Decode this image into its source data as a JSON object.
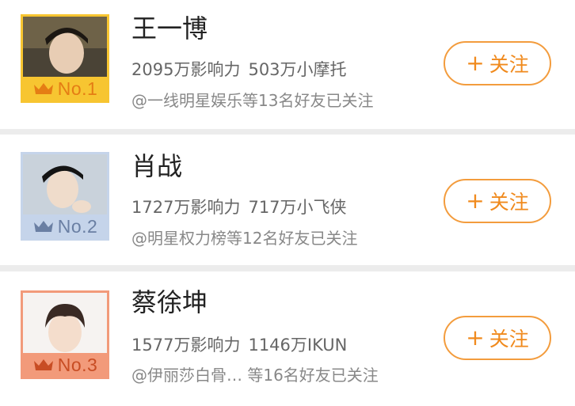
{
  "influencers": [
    {
      "name": "王一博",
      "rank": "No.1",
      "influence": "2095万影响力",
      "fans": "503万小摩托",
      "friends": "@一线明星娱乐等13名好友已关注",
      "follow_label": "关注",
      "follow_icon": "+",
      "theme": {
        "band": "#f7c531",
        "text": "#e57d14"
      }
    },
    {
      "name": "肖战",
      "rank": "No.2",
      "influence": "1727万影响力",
      "fans": "717万小飞侠",
      "friends": "@明星权力榜等12名好友已关注",
      "follow_label": "关注",
      "follow_icon": "+",
      "theme": {
        "band": "#c5d4ea",
        "text": "#6a7fa3"
      }
    },
    {
      "name": "蔡徐坤",
      "rank": "No.3",
      "influence": "1577万影响力",
      "fans": "1146万IKUN",
      "friends": "@伊丽莎白骨… 等16名好友已关注",
      "follow_label": "关注",
      "follow_icon": "+",
      "theme": {
        "band": "#f29a7a",
        "text": "#c84d24"
      }
    }
  ],
  "colors": {
    "accent": "#f08a1d",
    "page_bg": "#ececec",
    "card_bg": "#ffffff"
  },
  "icons": [
    "crown-icon",
    "plus-icon"
  ]
}
